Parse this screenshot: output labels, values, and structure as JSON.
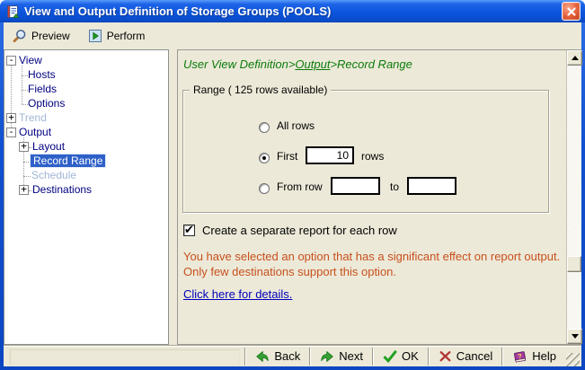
{
  "window": {
    "title": "View and Output Definition of Storage Groups (POOLS)"
  },
  "toolbar": {
    "preview": "Preview",
    "perform": "Perform"
  },
  "tree": {
    "items": [
      {
        "label": "View",
        "expander": "-"
      },
      {
        "label": "Hosts"
      },
      {
        "label": "Fields"
      },
      {
        "label": "Options"
      },
      {
        "label": "Trend",
        "expander": "+",
        "disabled": true
      },
      {
        "label": "Output",
        "expander": "-"
      },
      {
        "label": "Layout",
        "expander": "+"
      },
      {
        "label": "Record Range",
        "selected": true
      },
      {
        "label": "Schedule",
        "disabled": true
      },
      {
        "label": "Destinations",
        "expander": "+"
      }
    ]
  },
  "breadcrumb": {
    "part1": "User View Definition",
    "sep1": ">",
    "link": "Output",
    "sep2": ">",
    "current": "Record Range"
  },
  "range": {
    "legend": "Range ( 125 rows available)",
    "all_rows_label": "All rows",
    "all_selected": false,
    "first_label": "First",
    "first_selected": true,
    "first_value": "10",
    "first_suffix": "rows",
    "from_label": "From row",
    "from_selected": false,
    "from_value": "",
    "to_label": "to",
    "to_value": ""
  },
  "separate_report": {
    "label": "Create a separate report for each row",
    "checked": true,
    "check_glyph": "✔"
  },
  "warning": {
    "line1": "You have selected an option that has a significant effect on report output.",
    "line2": "Only few destinations support this option."
  },
  "details_link": {
    "label": "Click here for details."
  },
  "footer": {
    "back": "Back",
    "next": "Next",
    "ok": "OK",
    "cancel": "Cancel",
    "help": "Help"
  },
  "colors": {
    "titlebar_blue": "#0B55DE",
    "panel_beige": "#ECE9D8",
    "tree_navy": "#000080",
    "tree_disabled": "#A2B6D6",
    "selection_blue": "#2E60C8",
    "breadcrumb_green": "#0B7B0B",
    "warning_orange": "#C8501E",
    "link_blue": "#0000BB"
  }
}
